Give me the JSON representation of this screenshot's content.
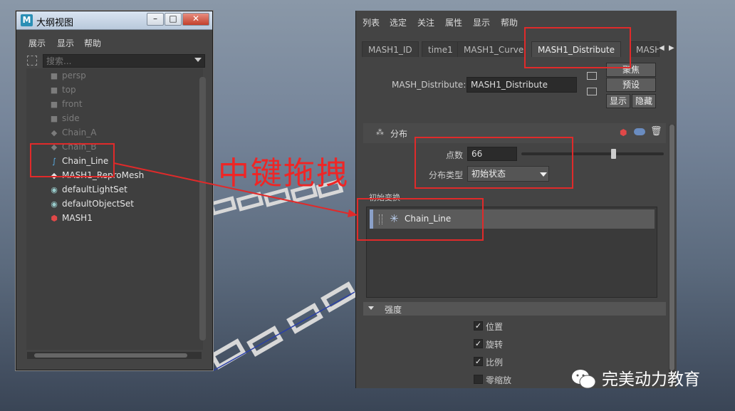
{
  "outliner": {
    "title": "大纲视图",
    "menu": [
      "展示",
      "显示",
      "帮助"
    ],
    "search_placeholder": "搜索...",
    "items": [
      {
        "label": "persp",
        "icon": "camera-icon"
      },
      {
        "label": "top",
        "icon": "camera-icon"
      },
      {
        "label": "front",
        "icon": "camera-icon"
      },
      {
        "label": "side",
        "icon": "camera-icon"
      },
      {
        "label": "Chain_A",
        "icon": "mesh-icon"
      },
      {
        "label": "Chain_B",
        "icon": "mesh-icon"
      },
      {
        "label": "Chain_Line",
        "icon": "curve-icon"
      },
      {
        "label": "MASH1_ReproMesh",
        "icon": "mesh-icon"
      },
      {
        "label": "defaultLightSet",
        "icon": "set-icon"
      },
      {
        "label": "defaultObjectSet",
        "icon": "set-icon"
      },
      {
        "label": "MASH1",
        "icon": "mash-icon"
      }
    ]
  },
  "attribute_editor": {
    "menu": [
      "列表",
      "选定",
      "关注",
      "属性",
      "显示",
      "帮助"
    ],
    "tabs": [
      "MASH1_ID",
      "time1",
      "MASH1_Curve",
      "MASH1_Distribute",
      "MASH"
    ],
    "active_tab": "MASH1_Distribute",
    "node_label": "MASH_Distribute:",
    "node_value": "MASH1_Distribute",
    "buttons": {
      "focus": "聚焦",
      "presets": "预设",
      "show": "显示",
      "hide": "隐藏"
    },
    "section_distribute": "分布",
    "points_label": "点数",
    "points_value": "66",
    "points_slider_fraction": 0.63,
    "dist_type_label": "分布类型",
    "dist_type_value": "初始状态",
    "initial_transform_label": "初始变换",
    "initial_item": "Chain_Line",
    "section_strength": "强度",
    "checkboxes": [
      {
        "label": "位置",
        "checked": true
      },
      {
        "label": "旋转",
        "checked": true
      },
      {
        "label": "比例",
        "checked": true
      },
      {
        "label": "零缩放",
        "checked": false
      }
    ]
  },
  "annotation": {
    "text": "中键拖拽",
    "color": "#e02a2a"
  },
  "watermark": {
    "text": "完美动力教育"
  }
}
